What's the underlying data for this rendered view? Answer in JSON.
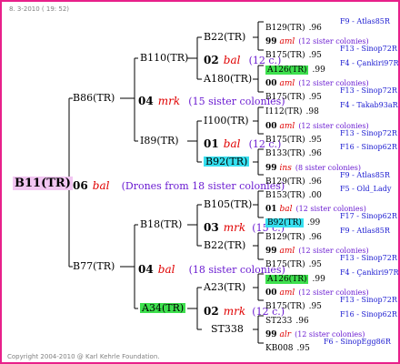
{
  "header": "8. 3-2010 ( 19: 52)",
  "footer": "Copyright 2004-2010 @ Karl Kehrle Foundation.",
  "root": {
    "label": "B11(TR)",
    "year": "06",
    "marker": "bal",
    "count": "(Drones from 18 sister colonies)"
  },
  "gen1": [
    {
      "label": "B86(TR)",
      "year": "04",
      "marker": "mrk",
      "count": "(15 sister colonies)"
    },
    {
      "label": "B77(TR)",
      "year": "04",
      "marker": "bal",
      "count": "(18 sister colonies)"
    }
  ],
  "gen2": [
    {
      "label": "B110(TR)"
    },
    {
      "label": "I89(TR)"
    },
    {
      "label": "B18(TR)"
    },
    {
      "label": "A34(TR)"
    }
  ],
  "gen3": [
    {
      "label": "B22(TR)",
      "year": "02",
      "marker": "bal",
      "count": "(12 c.)"
    },
    {
      "label": "A180(TR)"
    },
    {
      "label": "I100(TR)"
    },
    {
      "label": "B92(TR)",
      "year": "01",
      "marker": "bal",
      "count": "(12 c.)"
    },
    {
      "label": "B105(TR)"
    },
    {
      "label": "B22(TR)",
      "year": "03",
      "marker": "mrk",
      "count": "(15 c.)"
    },
    {
      "label": "A23(TR)"
    },
    {
      "label": "ST338",
      "year": "02",
      "marker": "mrk",
      "count": "(12 c.)"
    }
  ],
  "gen4": [
    {
      "label": "B129(TR)",
      "value": ".96",
      "info": "F9 - Atlas85R"
    },
    {
      "year": "99",
      "marker": "aml",
      "count": "(12 sister colonies)"
    },
    {
      "label": "B175(TR)",
      "value": ".95",
      "info": "F13 - Sinop72R"
    },
    {
      "label": "A126(TR)",
      "value": ".99",
      "info": "F4 - Çankiri97R"
    },
    {
      "year": "00",
      "marker": "aml",
      "count": "(12 sister colonies)"
    },
    {
      "label": "B175(TR)",
      "value": ".95",
      "info": "F13 - Sinop72R"
    },
    {
      "label": "I112(TR)",
      "value": ".98",
      "info": "F4 - Takab93aR"
    },
    {
      "year": "00",
      "marker": "aml",
      "count": "(12 sister colonies)"
    },
    {
      "label": "B175(TR)",
      "value": ".95",
      "info": "F13 - Sinop72R"
    },
    {
      "label": "B133(TR)",
      "value": ".96",
      "info": "F16 - Sinop62R"
    },
    {
      "year": "99",
      "marker": "ins",
      "count": "(8 sister colonies)"
    },
    {
      "label": "B129(TR)",
      "value": ".96",
      "info": "F9 - Atlas85R"
    },
    {
      "label": "B153(TR)",
      "value": ".00",
      "info": "F5 - Old_Lady"
    },
    {
      "year": "01",
      "marker": "bal",
      "count": "(12 sister colonies)"
    },
    {
      "label": "B92(TR)",
      "value": ".99",
      "info": "F17 - Sinop62R"
    },
    {
      "label": "B129(TR)",
      "value": ".96",
      "info": "F9 - Atlas85R"
    },
    {
      "year": "99",
      "marker": "aml",
      "count": "(12 sister colonies)"
    },
    {
      "label": "B175(TR)",
      "value": ".95",
      "info": "F13 - Sinop72R"
    },
    {
      "label": "A126(TR)",
      "value": ".99",
      "info": "F4 - Çankiri97R"
    },
    {
      "year": "00",
      "marker": "aml",
      "count": "(12 sister colonies)"
    },
    {
      "label": "B175(TR)",
      "value": ".95",
      "info": "F13 - Sinop72R"
    },
    {
      "label": "ST233",
      "value": ".96",
      "info": "F16 - Sinop62R"
    },
    {
      "year": "99",
      "marker": "alr",
      "count": "(12 sister colonies)"
    },
    {
      "label": "KB008",
      "value": ".95",
      "info": "F6 - SinopEgg86R"
    }
  ],
  "colors": {
    "border": "#e8208a",
    "root_bg": "#f2c6f2",
    "green_bg": "#3ee04e",
    "cyan_bg": "#36e0f0",
    "marker": "#e00000",
    "count": "#6a1bd1",
    "info": "#1a1ad0"
  }
}
